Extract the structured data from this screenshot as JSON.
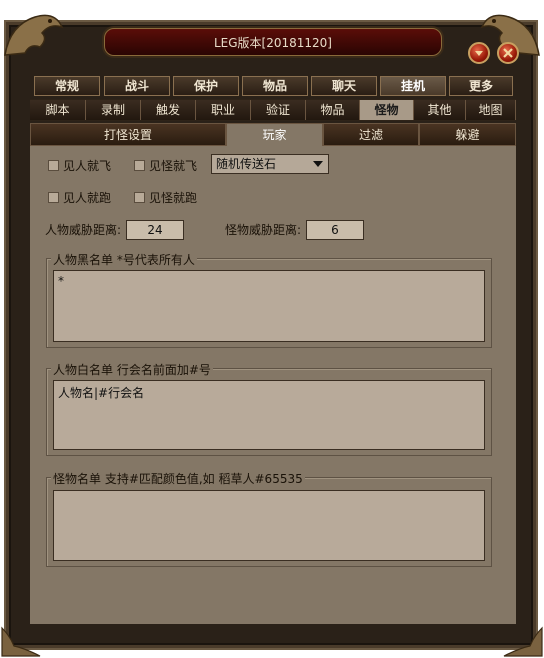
{
  "window": {
    "title": "LEG版本[20181120]"
  },
  "tabs_main": [
    {
      "label": "常规"
    },
    {
      "label": "战斗"
    },
    {
      "label": "保护"
    },
    {
      "label": "物品"
    },
    {
      "label": "聊天"
    },
    {
      "label": "挂机"
    },
    {
      "label": "更多"
    }
  ],
  "tabs_sub": [
    {
      "label": "脚本"
    },
    {
      "label": "录制"
    },
    {
      "label": "触发"
    },
    {
      "label": "职业"
    },
    {
      "label": "验证"
    },
    {
      "label": "物品"
    },
    {
      "label": "怪物"
    },
    {
      "label": "其他"
    },
    {
      "label": "地图"
    }
  ],
  "tabs_section": [
    {
      "label": "打怪设置"
    },
    {
      "label": "玩家"
    },
    {
      "label": "过滤"
    },
    {
      "label": "躲避"
    }
  ],
  "options": {
    "fly_on_player": "见人就飞",
    "fly_on_monster": "见怪就飞",
    "teleport_select": "随机传送石",
    "run_on_player": "见人就跑",
    "run_on_monster": "见怪就跑"
  },
  "distances": {
    "player_label": "人物威胁距离:",
    "player_value": "24",
    "monster_label": "怪物威胁距离:",
    "monster_value": "6"
  },
  "blacklist": {
    "title": "人物黑名单  *号代表所有人",
    "value": "*"
  },
  "whitelist": {
    "title": "人物白名单  行会名前面加#号",
    "value": "人物名|#行会名"
  },
  "monsterlist": {
    "title": "怪物名单  支持#匹配颜色值,如 稻草人#65535",
    "value": ""
  },
  "colors": {
    "panel": "#847766",
    "frame": "#2a2118",
    "title_bar": "#5a0d08"
  }
}
